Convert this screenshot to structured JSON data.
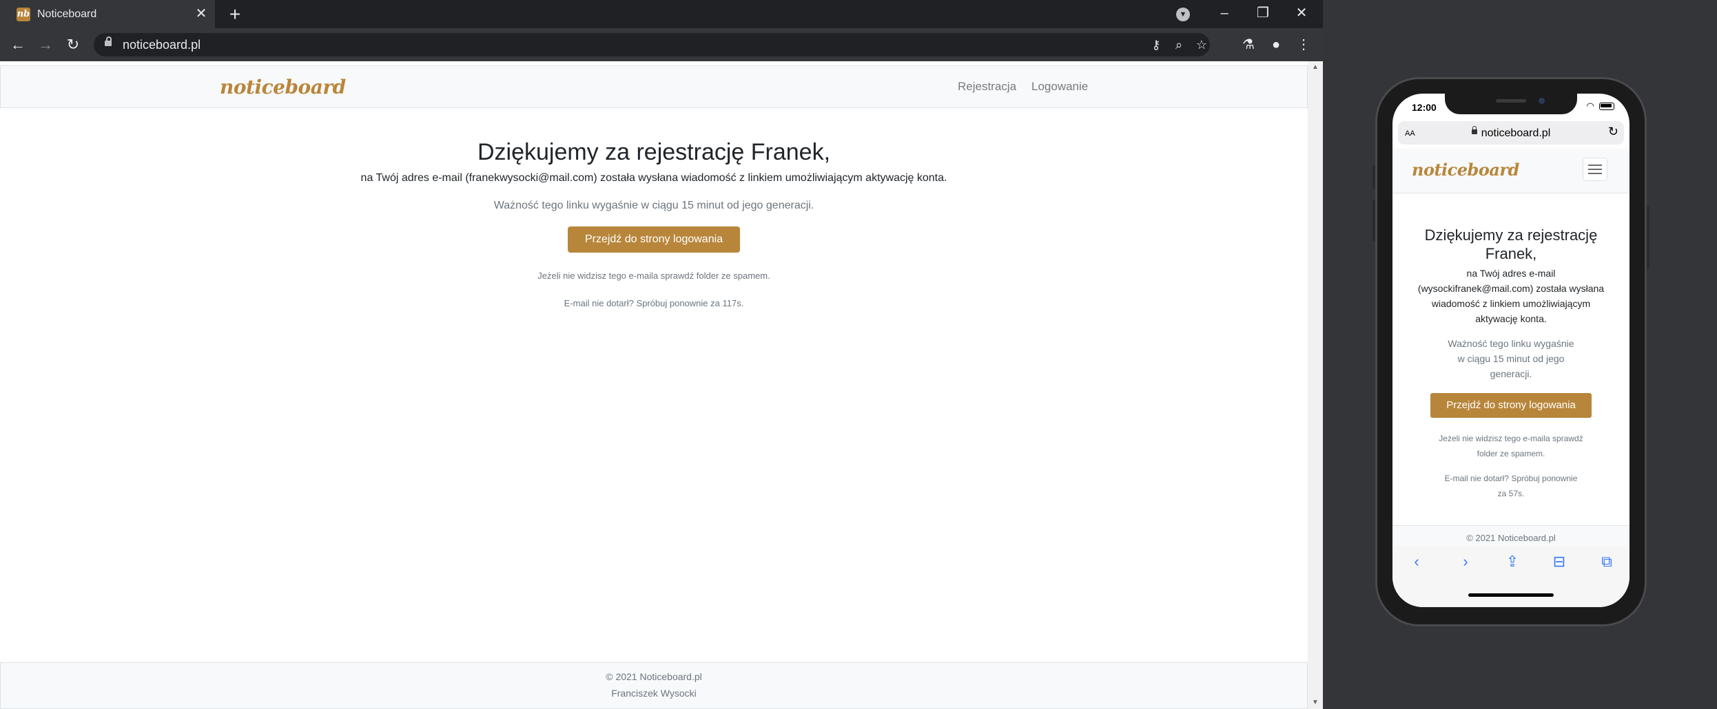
{
  "browser": {
    "tab_title": "Noticeboard",
    "favicon_text": "nb",
    "url": "noticeboard.pl"
  },
  "site": {
    "brand": "noticeboard",
    "nav": [
      "Rejestracja",
      "Logowanie"
    ],
    "heading": "Dziękujemy za rejestrację Franek,",
    "line1": "na Twój adres e-mail (franekwysocki@mail.com) została wysłana wiadomość z linkiem umożliwiającym aktywację konta.",
    "validity": "Ważność tego linku wygaśnie w ciągu 15 minut od jego generacji.",
    "button": "Przejdź do strony logowania",
    "spam_note": "Jeżeli nie widzisz tego e-maila sprawdź folder ze spamem.",
    "retry_note": "E-mail nie dotarł? Spróbuj ponownie za 117s.",
    "footer_copyright": "© 2021 Noticeboard.pl",
    "footer_author": "Franciszek Wysocki"
  },
  "mobile": {
    "time": "12:00",
    "text_size": "AA",
    "url": "noticeboard.pl",
    "brand": "noticeboard",
    "heading": "Dziękujemy za rejestrację Franek,",
    "line1": "na Twój adres e-mail (wysockifranek@mail.com) została wysłana wiadomość z linkiem umożliwiającym aktywację konta.",
    "validity": "Ważność tego linku wygaśnie w ciągu 15 minut od jego generacji.",
    "button": "Przejdź do strony logowania",
    "spam_note": "Jeżeli nie widzisz tego e-maila sprawdź folder ze spamem.",
    "retry_note": "E-mail nie dotarł? Spróbuj ponownie za 57s.",
    "footer_copyright": "© 2021 Noticeboard.pl"
  },
  "colors": {
    "accent": "#b8863b",
    "browser_chrome": "#202124",
    "toolbar": "#35363a"
  },
  "icons": {
    "tabbar": [
      "close-icon",
      "plus-icon",
      "profile-dropdown-icon",
      "minimize-icon",
      "restore-icon",
      "close-window-icon"
    ],
    "toolbar": [
      "back-arrow-icon",
      "forward-arrow-icon",
      "reload-icon",
      "lock-icon",
      "key-icon",
      "zoom-icon",
      "star-icon",
      "labs-flask-icon",
      "profile-icon",
      "kebab-menu-icon"
    ],
    "mobile": [
      "wifi-icon",
      "battery-icon",
      "lock-icon",
      "reload-icon",
      "hamburger-icon",
      "back-chevron-icon",
      "forward-chevron-icon",
      "share-icon",
      "bookmarks-icon",
      "tabs-icon"
    ]
  }
}
